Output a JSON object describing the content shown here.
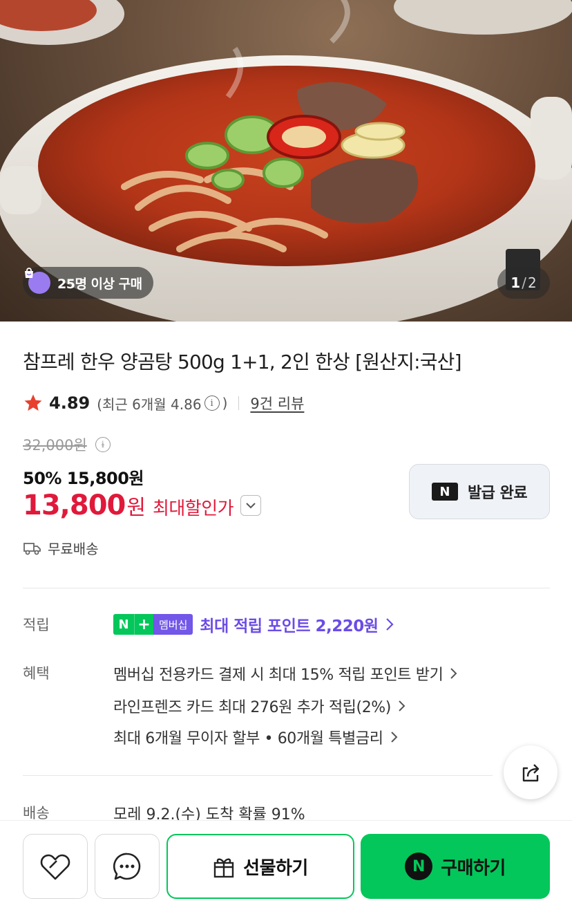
{
  "hero": {
    "image_alt": "한우 양곰탕",
    "buyers_badge": "25명 이상 구매",
    "pager": {
      "current": "1",
      "separator": "/",
      "total": "2"
    }
  },
  "product": {
    "title": "참프레 한우 양곰탕 500g 1+1, 2인 한상 [원산지:국산]",
    "rating": "4.89",
    "recent_rating_prefix": "(최근 6개월 4.86",
    "recent_rating_suffix": ")",
    "info_glyph": "i",
    "reviews_link": "9건 리뷰",
    "original_price": "32,000원",
    "discount_line": "50% 15,800원",
    "final_price": "13,800",
    "final_currency": "원",
    "max_discount_label": "최대할인가",
    "coupon_button": "발급 완료",
    "coupon_logo": "N",
    "shipping": "무료배송"
  },
  "details": {
    "points_label": "적립",
    "badge_n": "N",
    "badge_plus": "+",
    "badge_membership": "멤버십",
    "points_text": "최대 적립 포인트 2,220원",
    "benefits_label": "혜택",
    "benefits": [
      "멤버십 전용카드 결제 시 최대 15% 적립 포인트 받기",
      "라인프렌즈 카드 최대 276원 추가 적립(2%)",
      "최대 6개월 무이자 할부 • 60개월 특별금리"
    ],
    "delivery_label": "배송",
    "delivery_value": "모레 9.2.(수) 도착 확률 91%"
  },
  "bottom": {
    "gift_label": "선물하기",
    "buy_label": "구매하기",
    "buy_logo": "N"
  },
  "icons": [
    "shopping-bag-icon",
    "star-icon",
    "info-icon",
    "chevron-down-icon",
    "truck-icon",
    "chevron-right-icon",
    "share-icon",
    "heart-icon",
    "chat-icon",
    "gift-icon"
  ],
  "colors": {
    "accent_green": "#03c75a",
    "price_red": "#e0193b",
    "membership_purple": "#6b4ce6",
    "star": "#e8402f"
  }
}
